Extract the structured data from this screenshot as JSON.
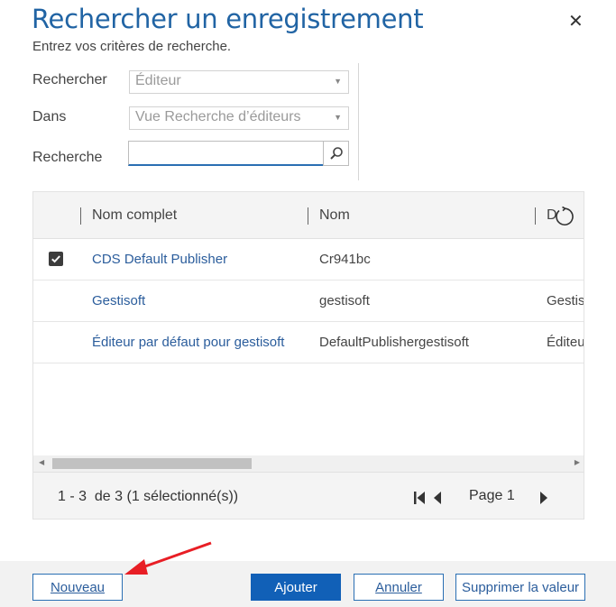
{
  "dialog": {
    "title": "Rechercher un enregistrement",
    "subtitle": "Entrez vos critères de recherche.",
    "close_glyph": "✕"
  },
  "form": {
    "rechercher_label": "Rechercher",
    "rechercher_value": "Éditeur",
    "dans_label": "Dans",
    "dans_value": "Vue Recherche d’éditeurs",
    "recherche_label": "Recherche",
    "recherche_value": ""
  },
  "grid": {
    "columns": [
      "Nom complet",
      "Nom",
      "D"
    ],
    "rows": [
      {
        "selected": true,
        "nom_complet": "CDS Default Publisher",
        "nom": "Cr941bc",
        "desc": ""
      },
      {
        "selected": false,
        "nom_complet": "Gestisoft",
        "nom": "gestisoft",
        "desc": "Gestis"
      },
      {
        "selected": false,
        "nom_complet": "Éditeur par défaut pour gestisoft",
        "nom": "DefaultPublishergestisoft",
        "desc": "Éditeu"
      }
    ],
    "status": "1 - 3  de 3 (1 sélectionné(s))",
    "page_label": "Page 1"
  },
  "buttons": {
    "nouveau": "Nouveau",
    "ajouter": "Ajouter",
    "annuler": "Annuler",
    "supprimer": "Supprimer la valeur"
  },
  "icons": {
    "close": "close-icon",
    "dropdown": "chevron-down-icon",
    "search": "search-icon",
    "refresh": "refresh-icon",
    "check": "check-icon",
    "first_page": "first-page-icon",
    "prev_page": "previous-page-icon",
    "next_page": "next-page-icon"
  },
  "colors": {
    "accent": "#2164a4",
    "link": "#2b5d9c",
    "primary_button": "#1160b7",
    "annotation_arrow": "#e81e25"
  }
}
